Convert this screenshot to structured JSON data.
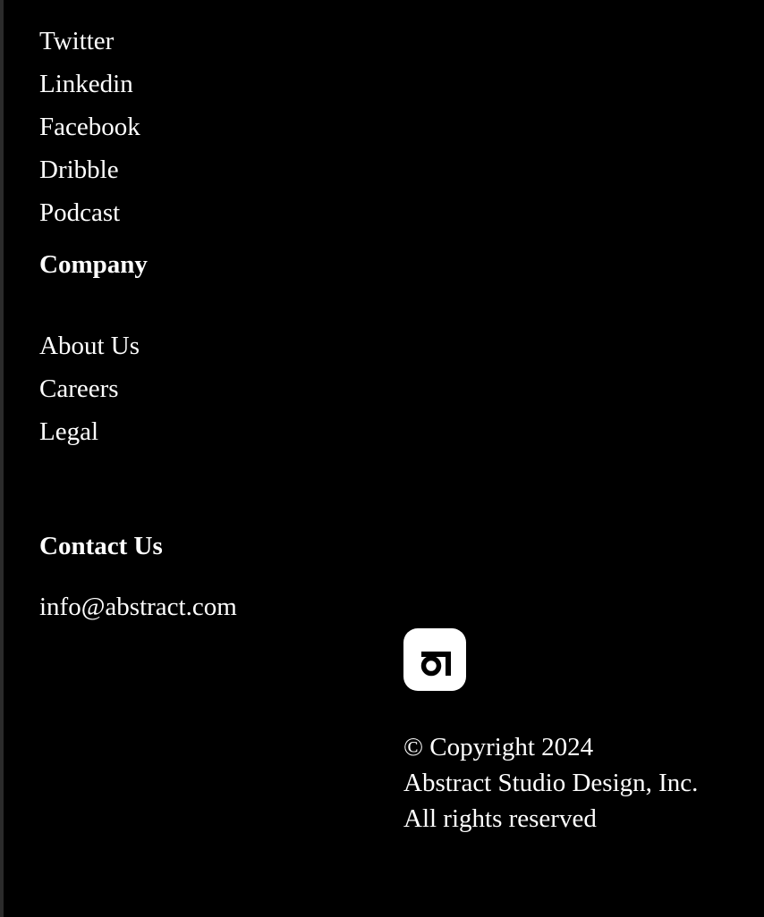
{
  "social": {
    "links": [
      "Twitter",
      "Linkedin",
      "Facebook",
      "Dribble",
      "Podcast"
    ]
  },
  "company": {
    "heading": "Company",
    "links": [
      "About Us",
      "Careers",
      "Legal"
    ]
  },
  "contact": {
    "heading": "Contact Us",
    "email": "info@abstract.com"
  },
  "logo": {
    "icon": "abstract-logo-icon",
    "background": "#ffffff",
    "foreground": "#000000"
  },
  "copyright": {
    "line1": "© Copyright 2024",
    "line2": "Abstract Studio Design, Inc.",
    "line3": "All rights reserved"
  },
  "colors": {
    "background": "#000000",
    "text": "#ffffff",
    "edge": "#2b2b2b"
  }
}
